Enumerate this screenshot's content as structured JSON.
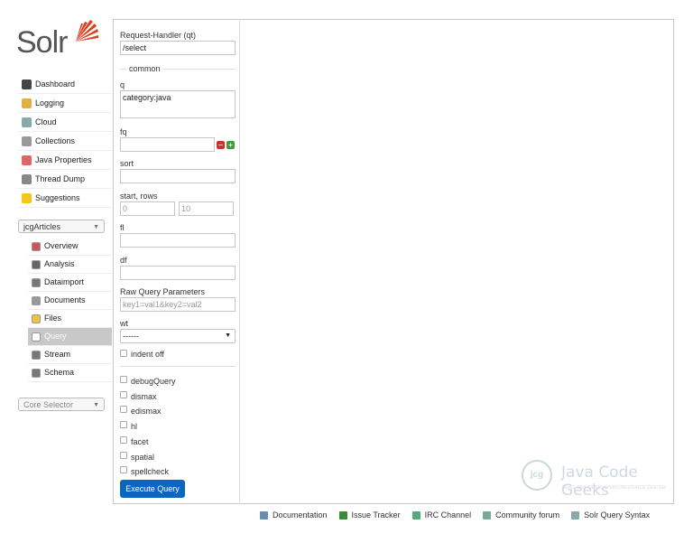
{
  "logo": {
    "text": "Solr"
  },
  "nav": {
    "items": [
      {
        "label": "Dashboard",
        "icon": "dashboard-icon",
        "color": "#444"
      },
      {
        "label": "Logging",
        "icon": "logging-icon",
        "color": "#e0b040"
      },
      {
        "label": "Cloud",
        "icon": "cloud-icon",
        "color": "#8aa"
      },
      {
        "label": "Collections",
        "icon": "collections-icon",
        "color": "#999"
      },
      {
        "label": "Java Properties",
        "icon": "java-icon",
        "color": "#d66"
      },
      {
        "label": "Thread Dump",
        "icon": "thread-icon",
        "color": "#888"
      },
      {
        "label": "Suggestions",
        "icon": "bulb-icon",
        "color": "#f5c518"
      }
    ]
  },
  "core_selector_top": {
    "value": "jcgArticles"
  },
  "core_nav": {
    "items": [
      {
        "label": "Overview",
        "icon": "home-icon",
        "color": "#c55"
      },
      {
        "label": "Analysis",
        "icon": "funnel-icon",
        "color": "#666"
      },
      {
        "label": "Dataimport",
        "icon": "import-icon",
        "color": "#777"
      },
      {
        "label": "Documents",
        "icon": "documents-icon",
        "color": "#999"
      },
      {
        "label": "Files",
        "icon": "folder-icon",
        "color": "#f0c040"
      },
      {
        "label": "Query",
        "icon": "search-icon",
        "color": "#fff"
      },
      {
        "label": "Stream",
        "icon": "stream-icon",
        "color": "#777"
      },
      {
        "label": "Schema",
        "icon": "schema-icon",
        "color": "#777"
      }
    ]
  },
  "core_selector_bottom": {
    "placeholder": "Core Selector"
  },
  "form": {
    "request_handler_label": "Request-Handler (qt)",
    "request_handler_value": "/select",
    "common_label": "common",
    "q_label": "q",
    "q_value": "category:java",
    "fq_label": "fq",
    "fq_value": "",
    "sort_label": "sort",
    "sort_value": "",
    "start_rows_label": "start, rows",
    "start_value": "0",
    "rows_value": "10",
    "fl_label": "fl",
    "fl_value": "",
    "df_label": "df",
    "df_value": "",
    "raw_label": "Raw Query Parameters",
    "raw_placeholder": "key1=val1&key2=val2",
    "wt_label": "wt",
    "wt_value": "------",
    "indent_label": "indent off",
    "checkboxes": [
      "debugQuery",
      "dismax",
      "edismax",
      "hl",
      "facet",
      "spatial",
      "spellcheck"
    ],
    "execute_label": "Execute Query"
  },
  "watermark": {
    "title": "Java Code Geeks",
    "sub": "JAVA 2 JAVA DEVELOPERS RESOURCE CENTER",
    "badge": "jcg"
  },
  "footer": {
    "items": [
      {
        "label": "Documentation",
        "icon": "documentation-icon",
        "color": "#6a8bb0"
      },
      {
        "label": "Issue Tracker",
        "icon": "bug-icon",
        "color": "#3a8a3a"
      },
      {
        "label": "IRC Channel",
        "icon": "irc-icon",
        "color": "#5a7"
      },
      {
        "label": "Community forum",
        "icon": "mail-icon",
        "color": "#7a9"
      },
      {
        "label": "Solr Query Syntax",
        "icon": "syntax-icon",
        "color": "#8aa"
      }
    ]
  },
  "colors": {
    "accent": "#0a66c2",
    "logo_orange": "#d9411e",
    "active": "#c8c8c8"
  }
}
